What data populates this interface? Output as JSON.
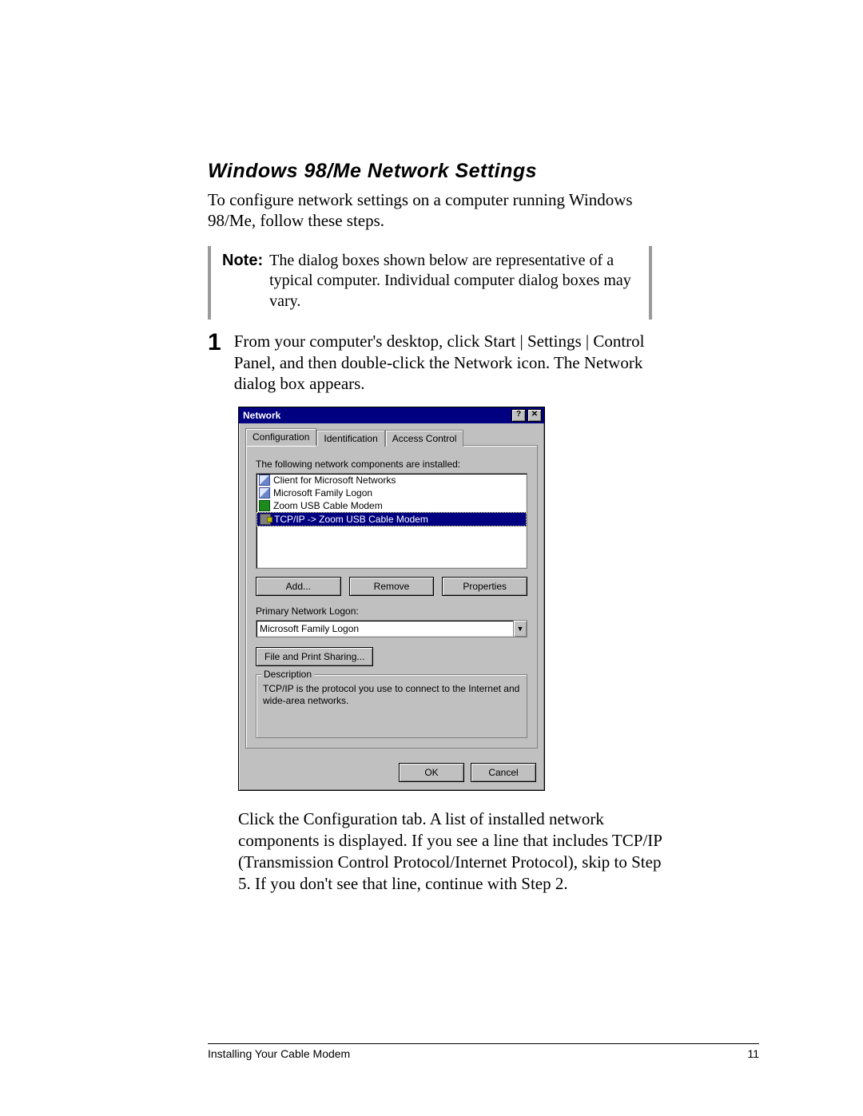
{
  "heading": "Windows 98/Me Network Settings",
  "intro": "To configure network settings on a computer running Windows 98/Me, follow these steps.",
  "note": {
    "label": "Note:",
    "text": "The dialog boxes shown below are representative of a typical computer. Individual computer dialog boxes may vary."
  },
  "step1": {
    "num": "1",
    "text": "From your computer's desktop, click Start | Settings | Control Panel, and then double-click the Network icon. The Network dialog box appears."
  },
  "dialog": {
    "title": "Network",
    "help_btn": "?",
    "close_btn": "✕",
    "tabs": [
      "Configuration",
      "Identification",
      "Access Control"
    ],
    "components_label": "The following network components are installed:",
    "components": [
      "Client for Microsoft Networks",
      "Microsoft Family Logon",
      "Zoom USB Cable Modem",
      "TCP/IP -> Zoom USB Cable Modem"
    ],
    "buttons": {
      "add": "Add...",
      "remove": "Remove",
      "properties": "Properties"
    },
    "logon_label": "Primary Network Logon:",
    "logon_value": "Microsoft Family Logon",
    "fileshare": "File and Print Sharing...",
    "desc_legend": "Description",
    "desc_text": "TCP/IP is the protocol you use to connect to the Internet and wide-area networks.",
    "ok": "OK",
    "cancel": "Cancel"
  },
  "after": "Click the Configuration tab. A list of installed network components is displayed. If you see a line that includes TCP/IP (Transmission Control Protocol/Internet Protocol), skip to Step 5. If you don't see that line, continue with Step 2.",
  "footer": {
    "left": "Installing Your Cable Modem",
    "right": "11"
  }
}
